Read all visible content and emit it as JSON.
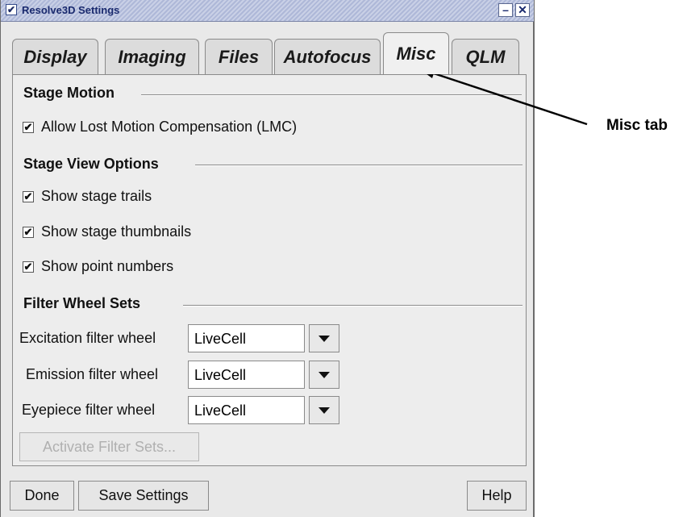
{
  "window": {
    "title": "Resolve3D Settings",
    "menu_glyph": "✔",
    "minimize_glyph": "–",
    "close_glyph": "✕"
  },
  "tabs": [
    {
      "label": "Display",
      "active": false
    },
    {
      "label": "Imaging",
      "active": false
    },
    {
      "label": "Files",
      "active": false
    },
    {
      "label": "Autofocus",
      "active": false
    },
    {
      "label": "Misc",
      "active": true
    },
    {
      "label": "QLM",
      "active": false
    }
  ],
  "stage_motion": {
    "title": "Stage Motion",
    "lmc": {
      "label": "Allow Lost Motion Compensation (LMC)",
      "checked": true
    }
  },
  "stage_view": {
    "title": "Stage View Options",
    "options": [
      {
        "label": "Show stage trails",
        "checked": true
      },
      {
        "label": "Show stage thumbnails",
        "checked": true
      },
      {
        "label": "Show point numbers",
        "checked": true
      }
    ]
  },
  "filter_wheels": {
    "title": "Filter Wheel Sets",
    "rows": [
      {
        "label": "Excitation filter wheel",
        "value": "LiveCell"
      },
      {
        "label": "Emission filter wheel",
        "value": "LiveCell"
      },
      {
        "label": "Eyepiece filter wheel",
        "value": "LiveCell"
      }
    ],
    "activate_label": "Activate Filter Sets...",
    "activate_enabled": false
  },
  "footer": {
    "done_label": "Done",
    "save_label": "Save Settings",
    "help_label": "Help"
  },
  "annotation": {
    "text": "Misc tab"
  },
  "check_glyph": "✔",
  "colors": {
    "titlebar": "#aeb8d8",
    "title_text": "#1a2a6e",
    "panel_bg": "#ededed",
    "disabled_text": "#b0b0b0"
  }
}
